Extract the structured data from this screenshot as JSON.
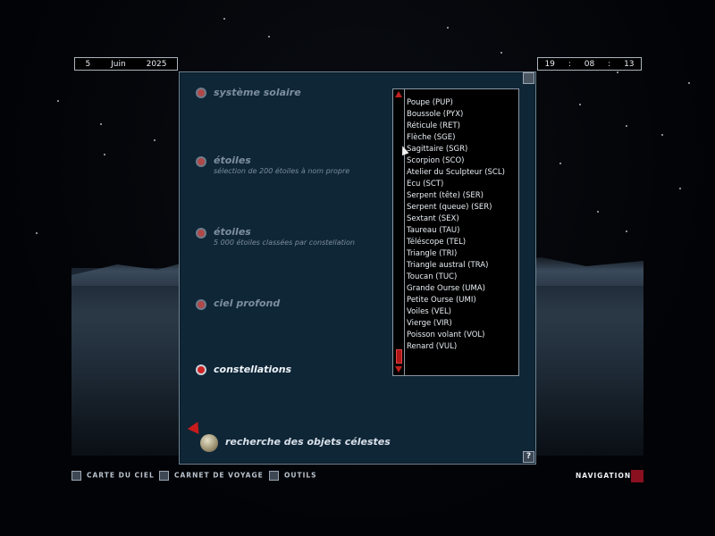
{
  "date": {
    "day": "5",
    "month": "Juin",
    "year": "2025"
  },
  "time": {
    "hours": "19",
    "minutes": "08",
    "seconds": "13",
    "sep1": ":",
    "sep2": ":"
  },
  "categories": [
    {
      "label": "système solaire",
      "subtitle": ""
    },
    {
      "label": "étoiles",
      "subtitle": "sélection de 200 étoiles à nom propre"
    },
    {
      "label": "étoiles",
      "subtitle": "5 000 étoiles classées par constellation"
    },
    {
      "label": "ciel profond",
      "subtitle": ""
    },
    {
      "label": "constellations",
      "subtitle": ""
    }
  ],
  "search": {
    "label": "recherche des objets célestes"
  },
  "help": {
    "label": "?"
  },
  "constellations_list": [
    "Poupe (PUP)",
    "Boussole (PYX)",
    "Réticule (RET)",
    "Flèche (SGE)",
    "Sagittaire (SGR)",
    "Scorpion (SCO)",
    "Atelier du Sculpteur (SCL)",
    "Ecu (SCT)",
    "Serpent (tête) (SER)",
    "Serpent (queue) (SER)",
    "Sextant (SEX)",
    "Taureau (TAU)",
    "Téléscope (TEL)",
    "Triangle (TRI)",
    "Triangle austral (TRA)",
    "Toucan (TUC)",
    "Grande Ourse (UMA)",
    "Petite Ourse (UMI)",
    "Voiles (VEL)",
    "Vierge (VIR)",
    "Poisson volant (VOL)",
    "Renard (VUL)"
  ],
  "bottom_menu": {
    "carte_du_ciel": "CARTE DU CIEL",
    "carnet_de_voyage": "CARNET DE VOYAGE",
    "outils": "OUTILS",
    "navigation": "NAVIGATION"
  },
  "colors": {
    "accent_red": "#c02020",
    "panel_bg": "#0f2637"
  }
}
